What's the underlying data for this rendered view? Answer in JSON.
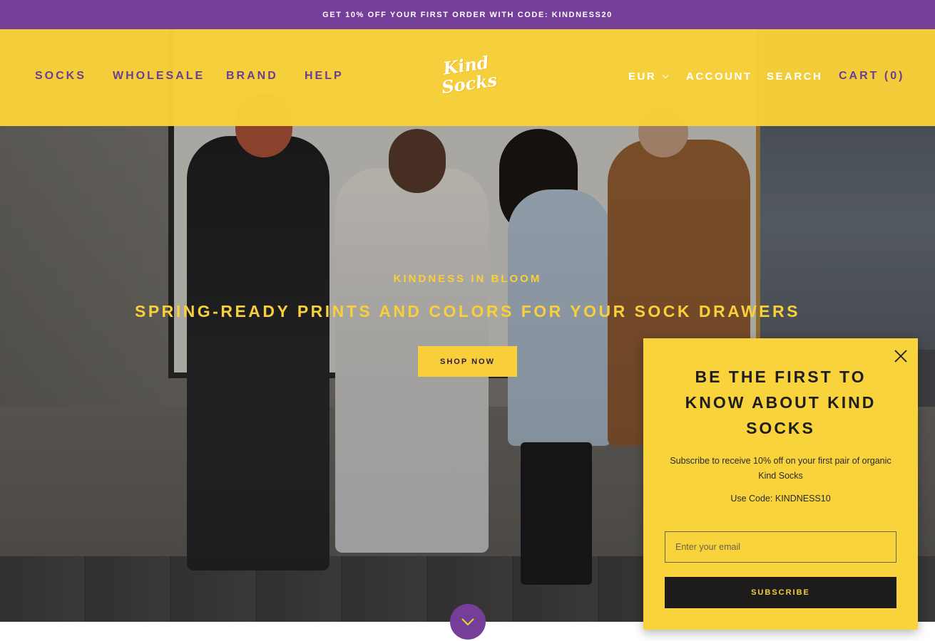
{
  "announcement": {
    "text": "GET 10% OFF YOUR FIRST ORDER WITH CODE: KINDNESS20"
  },
  "header": {
    "nav_left": [
      {
        "label": "SOCKS"
      },
      {
        "label": "WHOLESALE"
      },
      {
        "label": "BRAND"
      },
      {
        "label": "HELP"
      }
    ],
    "logo_line1": "Kind",
    "logo_line2": "Socks",
    "currency": "EUR",
    "account": "ACCOUNT",
    "search": "SEARCH",
    "cart": "CART (0)"
  },
  "hero": {
    "kicker": "KINDNESS IN BLOOM",
    "title": "SPRING-READY PRINTS AND COLORS FOR YOUR SOCK DRAWERS",
    "button": "SHOP NOW"
  },
  "popup": {
    "title": "BE THE FIRST TO KNOW ABOUT KIND SOCKS",
    "subtitle": "Subscribe to receive 10% off on your first pair of organic Kind Socks",
    "code": "Use Code: KINDNESS10",
    "email_placeholder": "Enter your email",
    "subscribe": "SUBSCRIBE"
  },
  "colors": {
    "brand_purple": "#753f99",
    "brand_yellow": "#f8cf3a",
    "dark": "#1d1b1c"
  },
  "icons": {
    "close": "close-icon",
    "chevron_down": "chevron-down-icon",
    "scroll_down": "scroll-down-icon"
  }
}
